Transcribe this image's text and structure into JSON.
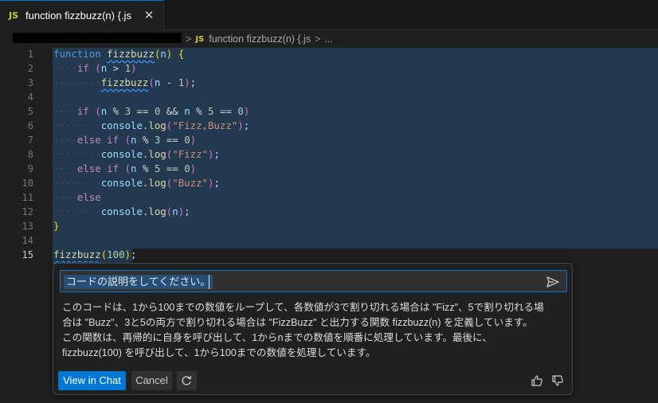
{
  "tab": {
    "icon": "JS",
    "title": "function fizzbuzz(n) {.js",
    "close_glyph": "✕"
  },
  "breadcrumb": {
    "separator": ">",
    "file_icon": "JS",
    "file": "function fizzbuzz(n) {.js",
    "trail": "..."
  },
  "line_numbers": [
    "1",
    "2",
    "3",
    "4",
    "5",
    "6",
    "7",
    "8",
    "9",
    "10",
    "11",
    "12",
    "13",
    "14",
    "15"
  ],
  "active_line": "15",
  "code": {
    "l1": {
      "kw": "function",
      "fn": "fizzbuzz",
      "p1": "(",
      "arg": "n",
      "p2": ")",
      "b": "{"
    },
    "l2": {
      "kw": "if",
      "p1": "(",
      "v": "n",
      "op": " > ",
      "n": "1",
      "p2": ")"
    },
    "l3": {
      "fn": "fizzbuzz",
      "p1": "(",
      "v": "n",
      "op": " - ",
      "n": "1",
      "p2": ")",
      "end": ";"
    },
    "l5": {
      "kw": "if",
      "p1": "(",
      "v1": "n",
      "op1": " % ",
      "n1": "3",
      "op2": " == ",
      "n2": "0",
      "and": " && ",
      "v2": "n",
      "op3": " % ",
      "n3": "5",
      "op4": " == ",
      "n4": "0",
      "p2": ")"
    },
    "l6": {
      "obj": "console",
      "dot": ".",
      "fn": "log",
      "p1": "(",
      "s": "\"Fizz,Buzz\"",
      "p2": ")",
      "end": ";"
    },
    "l7": {
      "kw1": "else",
      "kw2": "if",
      "p1": "(",
      "v": "n",
      "op1": " % ",
      "n1": "3",
      "op2": " == ",
      "n2": "0",
      "p2": ")"
    },
    "l8": {
      "obj": "console",
      "dot": ".",
      "fn": "log",
      "p1": "(",
      "s": "\"Fizz\"",
      "p2": ")",
      "end": ";"
    },
    "l9": {
      "kw1": "else",
      "kw2": "if",
      "p1": "(",
      "v": "n",
      "op1": " % ",
      "n1": "5",
      "op2": " == ",
      "n2": "0",
      "p2": ")"
    },
    "l10": {
      "obj": "console",
      "dot": ".",
      "fn": "log",
      "p1": "(",
      "s": "\"Buzz\"",
      "p2": ")",
      "end": ";"
    },
    "l11": {
      "kw": "else"
    },
    "l12": {
      "obj": "console",
      "dot": ".",
      "fn": "log",
      "p1": "(",
      "v": "n",
      "p2": ")",
      "end": ";"
    },
    "l13": {
      "b": "}"
    },
    "l15": {
      "fn": "fizzbuzz",
      "p1": "(",
      "n": "100",
      "p2": ")",
      "end": ";"
    }
  },
  "chat": {
    "input_value": "コードの説明をしてください。",
    "response_lines": [
      "このコードは、1から100までの数値をループして、各数値が3で割り切れる場合は \"Fizz\"、5で割り切れる場",
      "合は \"Buzz\"、3と5の両方で割り切れる場合は \"FizzBuzz\" と出力する関数 fizzbuzz(n) を定義しています。",
      "この関数は、再帰的に自身を呼び出して、1からnまでの数値を順番に処理しています。最後に、",
      "fizzbuzz(100) を呼び出して、1から100までの数値を処理しています。"
    ],
    "view_in_chat": "View in Chat",
    "cancel": "Cancel"
  },
  "colors": {
    "accent": "#0078d4",
    "selection": "#264f78",
    "js_icon": "#cbcb41"
  },
  "icons": {
    "send": "send-icon",
    "regenerate": "refresh-icon",
    "thumbs_up": "thumbs-up-icon",
    "thumbs_down": "thumbs-down-icon",
    "close": "close-icon"
  }
}
